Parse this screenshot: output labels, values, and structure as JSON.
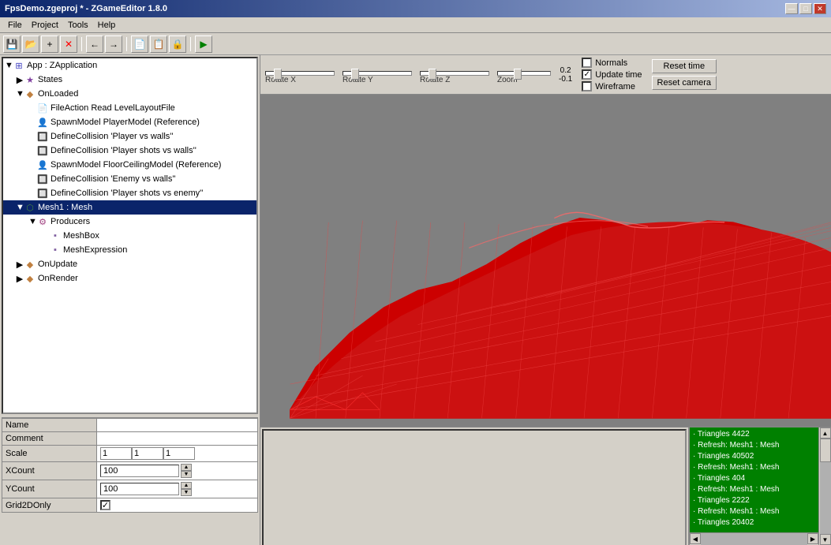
{
  "window": {
    "title": "FpsDemo.zgeproj * - ZGameEditor 1.8.0",
    "min_label": "—",
    "max_label": "□",
    "close_label": "✕"
  },
  "menu": {
    "items": [
      "File",
      "Project",
      "Tools",
      "Help"
    ]
  },
  "toolbar": {
    "buttons": [
      "💾",
      "📂",
      "+",
      "✕",
      "←",
      "→",
      "📄",
      "📋",
      "🔒",
      "▶"
    ]
  },
  "tree": {
    "items": [
      {
        "label": "App : ZApplication",
        "indent": 0,
        "expanded": true,
        "icon": "app"
      },
      {
        "label": "States",
        "indent": 1,
        "expanded": false,
        "icon": "state"
      },
      {
        "label": "OnLoaded",
        "indent": 1,
        "expanded": true,
        "icon": "on"
      },
      {
        "label": "FileAction Read LevelLayoutFile",
        "indent": 2,
        "icon": "action"
      },
      {
        "label": "SpawnModel PlayerModel (Reference)",
        "indent": 2,
        "icon": "model"
      },
      {
        "label": "DefineCollision 'Player vs walls''",
        "indent": 2,
        "icon": "collision"
      },
      {
        "label": "DefineCollision 'Player shots vs walls''",
        "indent": 2,
        "icon": "collision"
      },
      {
        "label": "SpawnModel FloorCeilingModel (Reference)",
        "indent": 2,
        "icon": "model"
      },
      {
        "label": "DefineCollision 'Enemy vs walls''",
        "indent": 2,
        "icon": "collision"
      },
      {
        "label": "DefineCollision 'Player shots vs enemy''",
        "indent": 2,
        "icon": "collision"
      },
      {
        "label": "Mesh1 : Mesh",
        "indent": 1,
        "expanded": true,
        "icon": "mesh",
        "selected": true
      },
      {
        "label": "Producers",
        "indent": 2,
        "expanded": true,
        "icon": "producer"
      },
      {
        "label": "MeshBox",
        "indent": 3,
        "icon": "meshbox"
      },
      {
        "label": "MeshExpression",
        "indent": 3,
        "icon": "meshbox"
      },
      {
        "label": "OnUpdate",
        "indent": 1,
        "icon": "on"
      },
      {
        "label": "OnRender",
        "indent": 1,
        "icon": "on"
      }
    ]
  },
  "properties": {
    "rows": [
      {
        "label": "Name",
        "value": "",
        "type": "input"
      },
      {
        "label": "Comment",
        "value": "",
        "type": "input"
      },
      {
        "label": "Scale",
        "value": "",
        "type": "scale",
        "values": [
          "1",
          "1",
          "1"
        ]
      },
      {
        "label": "XCount",
        "value": "100",
        "type": "spinner"
      },
      {
        "label": "YCount",
        "value": "100",
        "type": "spinner"
      },
      {
        "label": "Grid2DOnly",
        "value": "checked",
        "type": "checkbox"
      }
    ]
  },
  "viewport_controls": {
    "sliders": [
      {
        "label": "Rotate X",
        "thumb_pos": "10"
      },
      {
        "label": "Rotate Y",
        "thumb_pos": "10"
      },
      {
        "label": "Rotate Z",
        "thumb_pos": "10"
      },
      {
        "label": "Zoom",
        "thumb_pos": "20"
      }
    ],
    "numbers": {
      "top": "0.2",
      "bottom": "-0.1"
    },
    "checkboxes": [
      {
        "label": "Normals",
        "checked": false
      },
      {
        "label": "Wireframe",
        "checked": true
      },
      {
        "label": "Update time",
        "checked": false
      }
    ],
    "buttons": [
      "Reset time",
      "Reset camera"
    ]
  },
  "log": {
    "lines": [
      "· Triangles 4422",
      "· Refresh: Mesh1 : Mesh",
      "· Triangles 40502",
      "· Refresh: Mesh1 : Mesh",
      "· Triangles 404",
      "· Refresh: Mesh1 : Mesh",
      "· Triangles 2222",
      "· Refresh: Mesh1 : Mesh",
      "· Triangles 20402"
    ]
  },
  "icons": {
    "expand_open": "▼",
    "expand_closed": "▶",
    "dot": "·",
    "check": "✓",
    "spin_up": "▲",
    "spin_down": "▼"
  }
}
